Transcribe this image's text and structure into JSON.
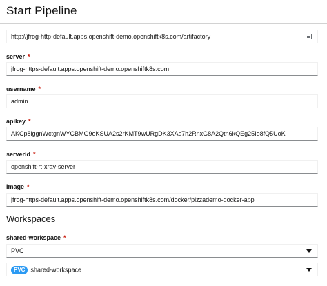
{
  "header": {
    "title": "Start Pipeline"
  },
  "fields": {
    "url": {
      "value": "http://jfrog-http-default.apps.openshift-demo.openshiftk8s.com/artifactory"
    },
    "server": {
      "label": "server",
      "required_mark": "*",
      "value": "jfrog-https-default.apps.openshift-demo.openshiftk8s.com"
    },
    "username": {
      "label": "username",
      "required_mark": "*",
      "value": "admin"
    },
    "apikey": {
      "label": "apikey",
      "required_mark": "*",
      "value": "AKCp8iggnWctgnWYCBMG9oKSUA2s2rKMT9wURgDK3XAs7h2RnxG8A2Qtn6kQEg25Io8fQ5UoK"
    },
    "serverid": {
      "label": "serverid",
      "required_mark": "*",
      "value": "openshift-rt-xray-server"
    },
    "image": {
      "label": "image",
      "required_mark": "*",
      "value": "jfrog-https-default.apps.openshift-demo.openshiftk8s.com/docker/pizzademo-docker-app"
    }
  },
  "workspaces": {
    "title": "Workspaces",
    "shared_workspace": {
      "label": "shared-workspace",
      "required_mark": "*",
      "type_value": "PVC",
      "claim_badge": "PVC",
      "claim_value": "shared-workspace"
    }
  },
  "icons": {
    "url_field_icon": "list-icon",
    "dropdown_icon": "caret-down-icon"
  }
}
